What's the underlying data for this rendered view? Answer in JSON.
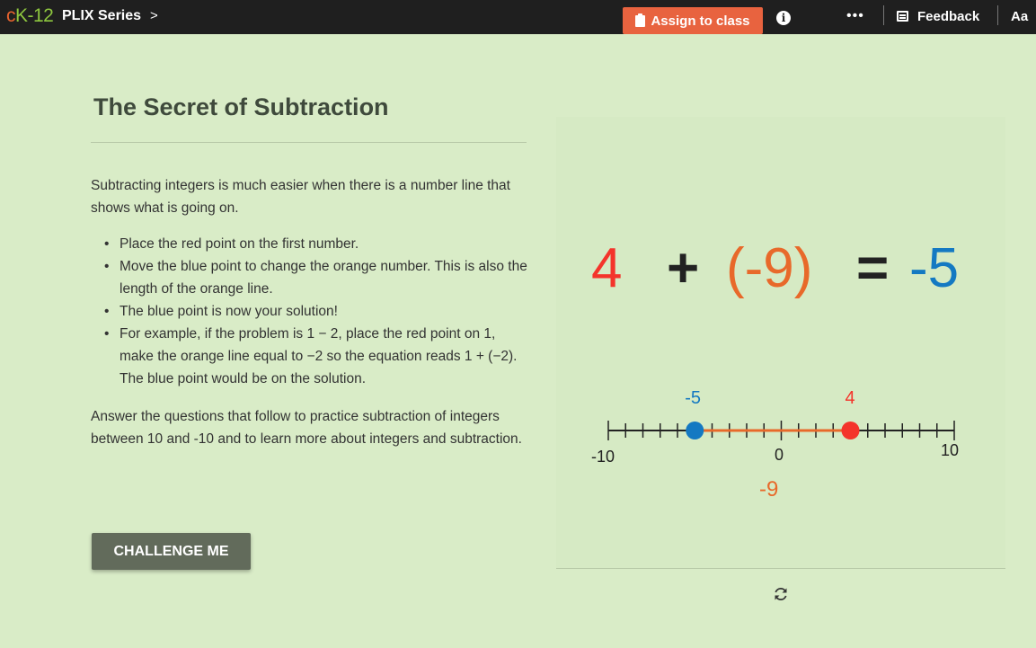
{
  "topbar": {
    "logo_c": "c",
    "logo_k": "K-12",
    "series": "PLIX Series",
    "chevron": ">",
    "assign_label": "Assign to class",
    "info_label": "i",
    "more_label": "•••",
    "feedback_label": "Feedback",
    "font_size_label": "Aa"
  },
  "content": {
    "title": "The Secret of Subtraction",
    "intro": "Subtracting integers is much easier when there is a number line that shows what is going on.",
    "bullets": [
      "Place the red point on the first number.",
      "Move the blue point to change the orange number.  This is also the length of the orange line.",
      "The blue point is now your solution!",
      "For example, if the problem is 1 − 2, place the red point on 1, make the orange line equal to −2 so the equation reads 1 + (−2). The blue point would be on the solution."
    ],
    "outro": "Answer the questions that follow to practice subtraction of integers between 10 and -10 and to learn more about integers and subtraction.",
    "challenge_label": "CHALLENGE ME"
  },
  "equation": {
    "first": "4",
    "plus": "+",
    "second": "(-9)",
    "equals": "=",
    "result": "-5"
  },
  "number_line": {
    "min": -10,
    "max": 10,
    "min_label": "-10",
    "zero_label": "0",
    "max_label": "10",
    "red_value": 4,
    "red_label": "4",
    "blue_value": -5,
    "blue_label": "-5",
    "orange_label": "-9"
  },
  "colors": {
    "red": "#f4342b",
    "blue": "#1479c2",
    "orange": "#e8692a",
    "button": "#626b5b",
    "assign": "#e8633f"
  }
}
